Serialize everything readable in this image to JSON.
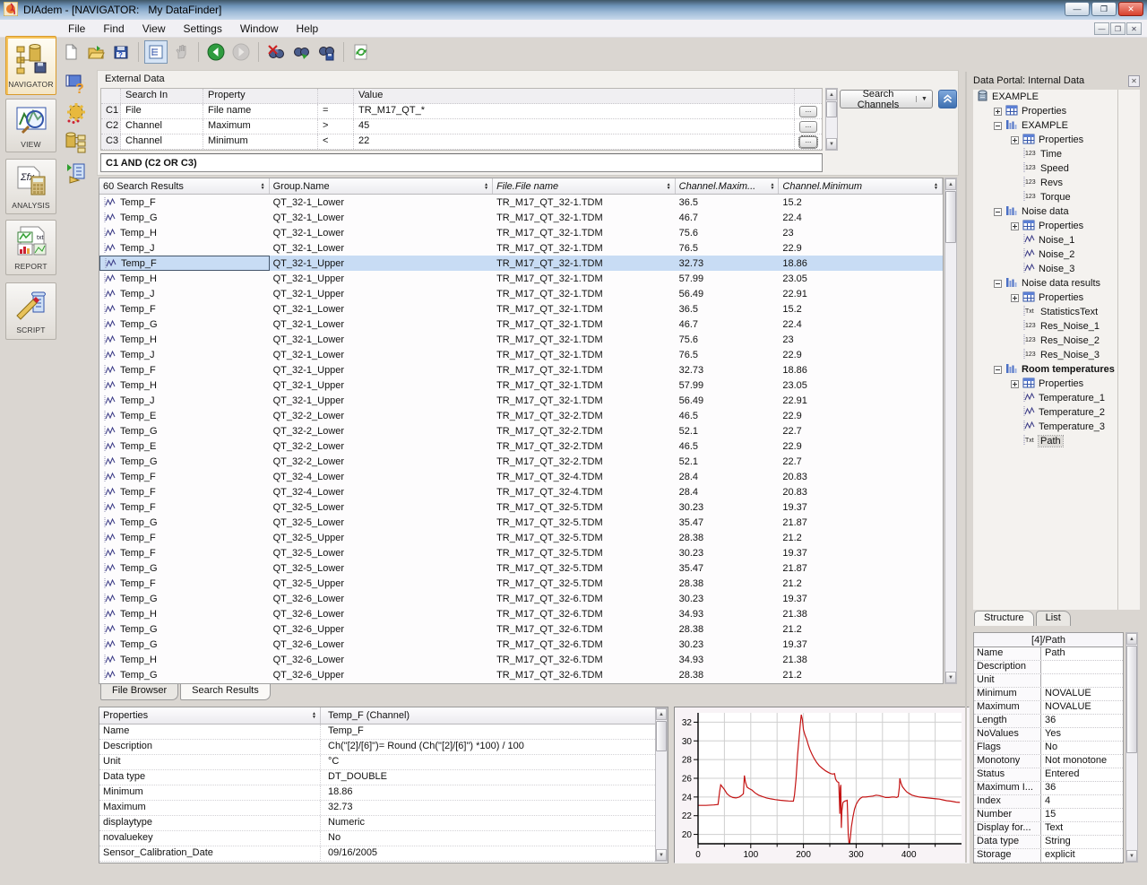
{
  "window": {
    "title": "DIAdem - [NAVIGATOR:   My DataFinder]",
    "buttons": [
      "minimize-button",
      "restore-button",
      "close-button"
    ],
    "mdi_buttons": [
      "mdi-minimize-button",
      "mdi-restore-button",
      "mdi-close-button"
    ]
  },
  "menu": {
    "items": [
      "File",
      "Find",
      "View",
      "Settings",
      "Window",
      "Help"
    ]
  },
  "toolbar": {
    "buttons": [
      {
        "name": "new-file-icon"
      },
      {
        "name": "open-file-icon"
      },
      {
        "name": "save-file-icon"
      },
      {
        "sep": true
      },
      {
        "name": "tree-view-icon",
        "pressed": true
      },
      {
        "name": "pan-hand-icon",
        "disabled": true
      },
      {
        "sep": true
      },
      {
        "name": "back-icon"
      },
      {
        "name": "forward-icon",
        "disabled": true
      },
      {
        "sep": true
      },
      {
        "name": "delete-search-results-icon"
      },
      {
        "name": "load-search-icon"
      },
      {
        "name": "save-search-icon"
      },
      {
        "sep": true
      },
      {
        "name": "refresh-icon"
      }
    ]
  },
  "sidebar": {
    "items": [
      {
        "label": "NAVIGATOR",
        "icon": "navigator-icon",
        "active": true
      },
      {
        "label": "VIEW",
        "icon": "view-icon",
        "active": false
      },
      {
        "label": "ANALYSIS",
        "icon": "analysis-icon",
        "active": false
      },
      {
        "label": "REPORT",
        "icon": "report-icon",
        "active": false
      },
      {
        "label": "SCRIPT",
        "icon": "script-icon",
        "active": false
      }
    ]
  },
  "side_icons": [
    "help-icon",
    "settings-gear-icon",
    "data-store-icon",
    "load-script-icon"
  ],
  "search_panel": {
    "title": "External Data",
    "columns": [
      "",
      "Search In",
      "Property",
      "",
      "Value"
    ],
    "conditions": [
      {
        "id": "C1",
        "search_in": "File",
        "property": "File name",
        "operator": "=",
        "value": "TR_M17_QT_*"
      },
      {
        "id": "C2",
        "search_in": "Channel",
        "property": "Maximum",
        "operator": ">",
        "value": "45"
      },
      {
        "id": "C3",
        "search_in": "Channel",
        "property": "Minimum",
        "operator": "<",
        "value": "22"
      }
    ],
    "ellipsis_label": "...",
    "logic": "C1 AND (C2 OR C3)",
    "search_button": "Search Channels"
  },
  "results": {
    "columns": [
      {
        "label": "60 Search Results",
        "italic": false
      },
      {
        "label": "Group.Name",
        "italic": false
      },
      {
        "label": "File.File name",
        "italic": true
      },
      {
        "label": "Channel.Maxim...",
        "italic": true
      },
      {
        "label": "Channel.Minimum",
        "italic": true
      }
    ],
    "selected_index": 4,
    "rows": [
      [
        "Temp_F",
        "QT_32-1_Lower",
        "TR_M17_QT_32-1.TDM",
        "36.5",
        "15.2"
      ],
      [
        "Temp_G",
        "QT_32-1_Lower",
        "TR_M17_QT_32-1.TDM",
        "46.7",
        "22.4"
      ],
      [
        "Temp_H",
        "QT_32-1_Lower",
        "TR_M17_QT_32-1.TDM",
        "75.6",
        "23"
      ],
      [
        "Temp_J",
        "QT_32-1_Lower",
        "TR_M17_QT_32-1.TDM",
        "76.5",
        "22.9"
      ],
      [
        "Temp_F",
        "QT_32-1_Upper",
        "TR_M17_QT_32-1.TDM",
        "32.73",
        "18.86"
      ],
      [
        "Temp_H",
        "QT_32-1_Upper",
        "TR_M17_QT_32-1.TDM",
        "57.99",
        "23.05"
      ],
      [
        "Temp_J",
        "QT_32-1_Upper",
        "TR_M17_QT_32-1.TDM",
        "56.49",
        "22.91"
      ],
      [
        "Temp_F",
        "QT_32-1_Lower",
        "TR_M17_QT_32-1.TDM",
        "36.5",
        "15.2"
      ],
      [
        "Temp_G",
        "QT_32-1_Lower",
        "TR_M17_QT_32-1.TDM",
        "46.7",
        "22.4"
      ],
      [
        "Temp_H",
        "QT_32-1_Lower",
        "TR_M17_QT_32-1.TDM",
        "75.6",
        "23"
      ],
      [
        "Temp_J",
        "QT_32-1_Lower",
        "TR_M17_QT_32-1.TDM",
        "76.5",
        "22.9"
      ],
      [
        "Temp_F",
        "QT_32-1_Upper",
        "TR_M17_QT_32-1.TDM",
        "32.73",
        "18.86"
      ],
      [
        "Temp_H",
        "QT_32-1_Upper",
        "TR_M17_QT_32-1.TDM",
        "57.99",
        "23.05"
      ],
      [
        "Temp_J",
        "QT_32-1_Upper",
        "TR_M17_QT_32-1.TDM",
        "56.49",
        "22.91"
      ],
      [
        "Temp_E",
        "QT_32-2_Lower",
        "TR_M17_QT_32-2.TDM",
        "46.5",
        "22.9"
      ],
      [
        "Temp_G",
        "QT_32-2_Lower",
        "TR_M17_QT_32-2.TDM",
        "52.1",
        "22.7"
      ],
      [
        "Temp_E",
        "QT_32-2_Lower",
        "TR_M17_QT_32-2.TDM",
        "46.5",
        "22.9"
      ],
      [
        "Temp_G",
        "QT_32-2_Lower",
        "TR_M17_QT_32-2.TDM",
        "52.1",
        "22.7"
      ],
      [
        "Temp_F",
        "QT_32-4_Lower",
        "TR_M17_QT_32-4.TDM",
        "28.4",
        "20.83"
      ],
      [
        "Temp_F",
        "QT_32-4_Lower",
        "TR_M17_QT_32-4.TDM",
        "28.4",
        "20.83"
      ],
      [
        "Temp_F",
        "QT_32-5_Lower",
        "TR_M17_QT_32-5.TDM",
        "30.23",
        "19.37"
      ],
      [
        "Temp_G",
        "QT_32-5_Lower",
        "TR_M17_QT_32-5.TDM",
        "35.47",
        "21.87"
      ],
      [
        "Temp_F",
        "QT_32-5_Upper",
        "TR_M17_QT_32-5.TDM",
        "28.38",
        "21.2"
      ],
      [
        "Temp_F",
        "QT_32-5_Lower",
        "TR_M17_QT_32-5.TDM",
        "30.23",
        "19.37"
      ],
      [
        "Temp_G",
        "QT_32-5_Lower",
        "TR_M17_QT_32-5.TDM",
        "35.47",
        "21.87"
      ],
      [
        "Temp_F",
        "QT_32-5_Upper",
        "TR_M17_QT_32-5.TDM",
        "28.38",
        "21.2"
      ],
      [
        "Temp_G",
        "QT_32-6_Lower",
        "TR_M17_QT_32-6.TDM",
        "30.23",
        "19.37"
      ],
      [
        "Temp_H",
        "QT_32-6_Lower",
        "TR_M17_QT_32-6.TDM",
        "34.93",
        "21.38"
      ],
      [
        "Temp_G",
        "QT_32-6_Upper",
        "TR_M17_QT_32-6.TDM",
        "28.38",
        "21.2"
      ],
      [
        "Temp_G",
        "QT_32-6_Lower",
        "TR_M17_QT_32-6.TDM",
        "30.23",
        "19.37"
      ],
      [
        "Temp_H",
        "QT_32-6_Lower",
        "TR_M17_QT_32-6.TDM",
        "34.93",
        "21.38"
      ],
      [
        "Temp_G",
        "QT_32-6_Upper",
        "TR_M17_QT_32-6.TDM",
        "28.38",
        "21.2"
      ]
    ]
  },
  "bottom_tabs": [
    {
      "label": "File Browser",
      "active": false
    },
    {
      "label": "Search Results",
      "active": true
    }
  ],
  "properties_panel": {
    "header_label": "Properties",
    "header_value": "Temp_F (Channel)",
    "rows": [
      [
        "Name",
        "Temp_F"
      ],
      [
        "Description",
        "Ch(\"[2]/[6]\")= Round (Ch(\"[2]/[6]\") *100) / 100"
      ],
      [
        "Unit",
        "°C"
      ],
      [
        "Data type",
        "DT_DOUBLE"
      ],
      [
        "Minimum",
        "18.86"
      ],
      [
        "Maximum",
        "32.73"
      ],
      [
        "displaytype",
        "Numeric"
      ],
      [
        "novaluekey",
        "No"
      ],
      [
        "Sensor_Calibration_Date",
        "09/16/2005"
      ]
    ]
  },
  "data_portal": {
    "title": "Data Portal: Internal Data",
    "tabs": [
      {
        "label": "Structure",
        "active": true
      },
      {
        "label": "List",
        "active": false
      }
    ],
    "tree": [
      {
        "label": "EXAMPLE",
        "level": 0,
        "icon": "root-data-icon",
        "expand": null
      },
      {
        "label": "Properties",
        "level": 1,
        "icon": "properties-icon",
        "expand": "plus"
      },
      {
        "label": "EXAMPLE",
        "level": 1,
        "icon": "group-icon",
        "expand": "minus"
      },
      {
        "label": "Properties",
        "level": 2,
        "icon": "properties-icon",
        "expand": "plus"
      },
      {
        "label": "Time",
        "level": 2,
        "icon": "numeric-channel-icon",
        "expand": null
      },
      {
        "label": "Speed",
        "level": 2,
        "icon": "numeric-channel-icon",
        "expand": null
      },
      {
        "label": "Revs",
        "level": 2,
        "icon": "numeric-channel-icon",
        "expand": null
      },
      {
        "label": "Torque",
        "level": 2,
        "icon": "numeric-channel-icon",
        "expand": null
      },
      {
        "label": "Noise data",
        "level": 1,
        "icon": "group-icon",
        "expand": "minus"
      },
      {
        "label": "Properties",
        "level": 2,
        "icon": "properties-icon",
        "expand": "plus"
      },
      {
        "label": "Noise_1",
        "level": 2,
        "icon": "waveform-channel-icon",
        "expand": null
      },
      {
        "label": "Noise_2",
        "level": 2,
        "icon": "waveform-channel-icon",
        "expand": null
      },
      {
        "label": "Noise_3",
        "level": 2,
        "icon": "waveform-channel-icon",
        "expand": null
      },
      {
        "label": "Noise data results",
        "level": 1,
        "icon": "group-icon",
        "expand": "minus"
      },
      {
        "label": "Properties",
        "level": 2,
        "icon": "properties-icon",
        "expand": "plus"
      },
      {
        "label": "StatisticsText",
        "level": 2,
        "icon": "text-channel-icon",
        "expand": null
      },
      {
        "label": "Res_Noise_1",
        "level": 2,
        "icon": "numeric-channel-icon",
        "expand": null
      },
      {
        "label": "Res_Noise_2",
        "level": 2,
        "icon": "numeric-channel-icon",
        "expand": null
      },
      {
        "label": "Res_Noise_3",
        "level": 2,
        "icon": "numeric-channel-icon",
        "expand": null
      },
      {
        "label": "Room temperatures",
        "level": 1,
        "icon": "group-icon",
        "expand": "minus",
        "bold": true
      },
      {
        "label": "Properties",
        "level": 2,
        "icon": "properties-icon",
        "expand": "plus"
      },
      {
        "label": "Temperature_1",
        "level": 2,
        "icon": "waveform-channel-icon",
        "expand": null
      },
      {
        "label": "Temperature_2",
        "level": 2,
        "icon": "waveform-channel-icon",
        "expand": null
      },
      {
        "label": "Temperature_3",
        "level": 2,
        "icon": "waveform-channel-icon",
        "expand": null
      },
      {
        "label": "Path",
        "level": 2,
        "icon": "text-channel-icon",
        "expand": null,
        "selected": true
      }
    ],
    "grid": {
      "header": "[4]/Path",
      "rows": [
        [
          "Name",
          "Path"
        ],
        [
          "Description",
          ""
        ],
        [
          "Unit",
          ""
        ],
        [
          "Minimum",
          "NOVALUE"
        ],
        [
          "Maximum",
          "NOVALUE"
        ],
        [
          "Length",
          "36"
        ],
        [
          "NoValues",
          "Yes"
        ],
        [
          "Flags",
          "No"
        ],
        [
          "Monotony",
          "Not monotone"
        ],
        [
          "Status",
          "Entered"
        ],
        [
          "Maximum I...",
          "36"
        ],
        [
          "Index",
          "4"
        ],
        [
          "Number",
          "15"
        ],
        [
          "Display for...",
          "Text"
        ],
        [
          "Data type",
          "String"
        ],
        [
          "Storage",
          "explicit"
        ]
      ]
    }
  },
  "chart_data": {
    "type": "line",
    "title": "",
    "xlabel": "",
    "ylabel": "",
    "xlim": [
      0,
      500
    ],
    "ylim": [
      19,
      33
    ],
    "xticks": [
      0,
      100,
      200,
      300,
      400
    ],
    "xminor_step": 50,
    "yticks": [
      20,
      22,
      24,
      26,
      28,
      30,
      32
    ],
    "grid": true,
    "line_color": "#C41414",
    "legend": null,
    "series": [
      {
        "name": "Temp_F",
        "points": [
          [
            0,
            23.1
          ],
          [
            15,
            23.1
          ],
          [
            30,
            23.15
          ],
          [
            38,
            23.2
          ],
          [
            41,
            24.6
          ],
          [
            43,
            25.3
          ],
          [
            46,
            25.1
          ],
          [
            50,
            24.8
          ],
          [
            55,
            24.35
          ],
          [
            60,
            24.1
          ],
          [
            66,
            23.95
          ],
          [
            72,
            23.9
          ],
          [
            78,
            24.0
          ],
          [
            83,
            24.2
          ],
          [
            86,
            24.35
          ],
          [
            88,
            26.3
          ],
          [
            90,
            25.6
          ],
          [
            93,
            25.05
          ],
          [
            97,
            24.9
          ],
          [
            102,
            24.75
          ],
          [
            108,
            24.45
          ],
          [
            115,
            24.2
          ],
          [
            122,
            24.05
          ],
          [
            130,
            23.9
          ],
          [
            138,
            23.8
          ],
          [
            147,
            23.72
          ],
          [
            156,
            23.65
          ],
          [
            165,
            23.6
          ],
          [
            172,
            23.57
          ],
          [
            181,
            23.55
          ],
          [
            183,
            24.2
          ],
          [
            186,
            26.0
          ],
          [
            189,
            28.5
          ],
          [
            192,
            30.5
          ],
          [
            194,
            31.8
          ],
          [
            196,
            32.8
          ],
          [
            198,
            32.3
          ],
          [
            200,
            31.2
          ],
          [
            203,
            30.6
          ],
          [
            206,
            30.2
          ],
          [
            209,
            29.6
          ],
          [
            212,
            29.1
          ],
          [
            216,
            28.6
          ],
          [
            220,
            28.15
          ],
          [
            225,
            27.7
          ],
          [
            230,
            27.35
          ],
          [
            236,
            27.05
          ],
          [
            242,
            26.8
          ],
          [
            248,
            26.6
          ],
          [
            252,
            26.5
          ],
          [
            256,
            26.45
          ],
          [
            259,
            26.5
          ],
          [
            261,
            25.9
          ],
          [
            264,
            25.65
          ],
          [
            267,
            25.55
          ],
          [
            268,
            24.0
          ],
          [
            269,
            22.2
          ],
          [
            270,
            25.0
          ],
          [
            271,
            25.3
          ],
          [
            272,
            20.7
          ],
          [
            273,
            22.5
          ],
          [
            275,
            23.4
          ],
          [
            278,
            23.55
          ],
          [
            281,
            23.6
          ],
          [
            283,
            23.65
          ],
          [
            284,
            22.0
          ],
          [
            285,
            20.0
          ],
          [
            287,
            18.7
          ],
          [
            289,
            19.6
          ],
          [
            291,
            20.8
          ],
          [
            294,
            21.9
          ],
          [
            297,
            22.7
          ],
          [
            300,
            23.2
          ],
          [
            304,
            23.6
          ],
          [
            308,
            23.85
          ],
          [
            312,
            24.0
          ],
          [
            318,
            24.0
          ],
          [
            325,
            24.05
          ],
          [
            332,
            24.1
          ],
          [
            338,
            24.2
          ],
          [
            344,
            24.15
          ],
          [
            350,
            24.05
          ],
          [
            356,
            23.95
          ],
          [
            362,
            23.95
          ],
          [
            368,
            24.0
          ],
          [
            373,
            24.0
          ],
          [
            377,
            23.95
          ],
          [
            380,
            24.05
          ],
          [
            382,
            25.0
          ],
          [
            383,
            26.0
          ],
          [
            385,
            25.5
          ],
          [
            388,
            25.1
          ],
          [
            392,
            24.8
          ],
          [
            396,
            24.55
          ],
          [
            400,
            24.4
          ],
          [
            406,
            24.2
          ],
          [
            412,
            24.1
          ],
          [
            420,
            24.0
          ],
          [
            428,
            23.95
          ],
          [
            436,
            23.9
          ],
          [
            444,
            23.85
          ],
          [
            452,
            23.8
          ],
          [
            458,
            23.78
          ],
          [
            464,
            23.7
          ],
          [
            472,
            23.6
          ],
          [
            480,
            23.55
          ],
          [
            490,
            23.45
          ],
          [
            497,
            23.42
          ]
        ]
      }
    ]
  }
}
